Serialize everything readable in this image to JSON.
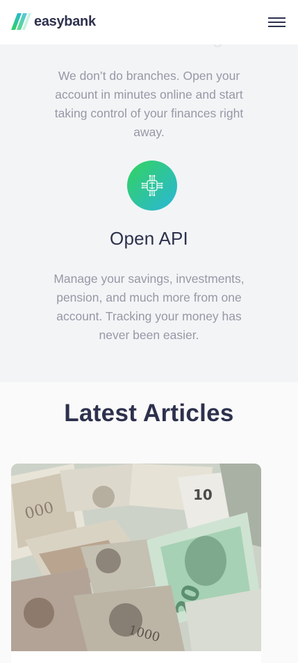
{
  "header": {
    "logo_text": "easybank",
    "menu_icon": "hamburger-icon"
  },
  "features": {
    "faded_title": "Fast Onboarding",
    "onboarding_text": "We don’t do branches. Open your account in minutes online and start taking control of your finances right away.",
    "api_icon": "api-chip-icon",
    "api_title": "Open API",
    "api_text": "Manage your savings, investments, pension, and much more from one account. Tracking your money has never been easier."
  },
  "articles": {
    "title": "Latest Articles",
    "first_image": "currency-banknotes-photo"
  },
  "colors": {
    "dark_blue": "#2d314d",
    "lime_green": "#31d35c",
    "bright_cyan": "#2bb7da",
    "grayish_blue": "#9698a6",
    "light_gray_bg": "#f4f5f7"
  }
}
